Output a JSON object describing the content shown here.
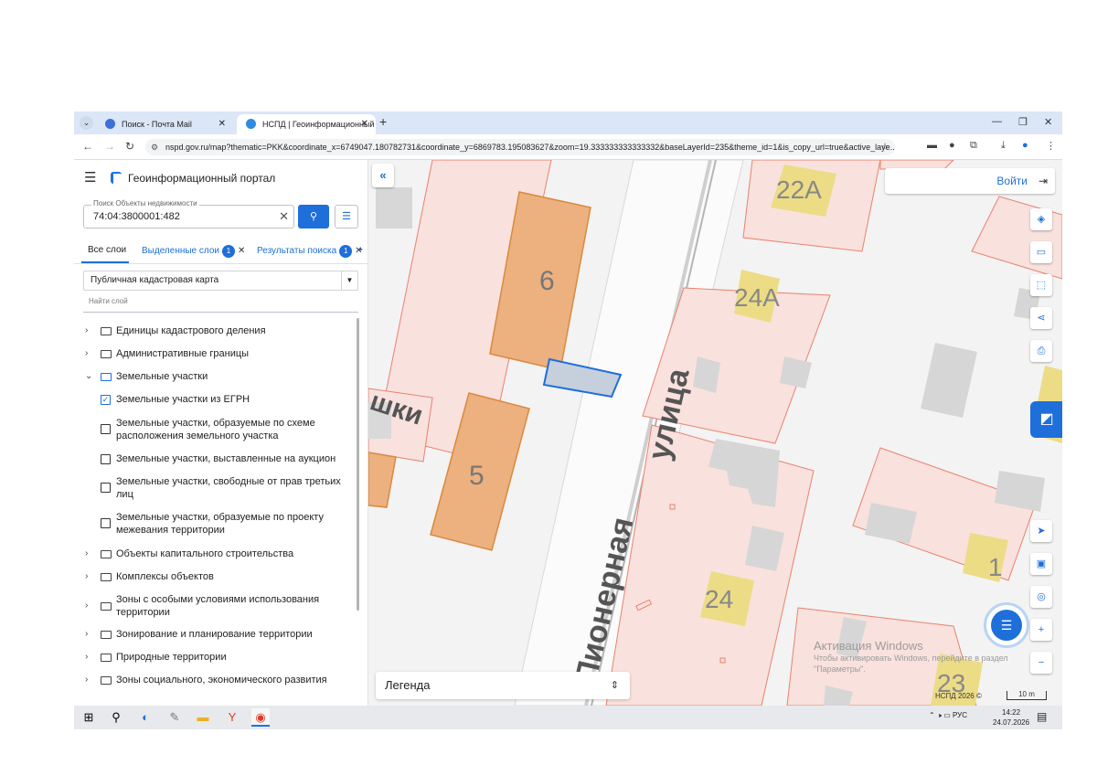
{
  "browser": {
    "tabs": [
      {
        "title": "Поиск - Почта Mail",
        "active": false
      },
      {
        "title": "НСПД | Геоинформационный",
        "active": true
      }
    ],
    "new_tab_icon": "plus-icon",
    "url": "nspd.gov.ru/map?thematic=PKK&coordinate_x=6749047.180782731&coordinate_y=6869783.195083627&zoom=19.333333333333332&baseLayerId=235&theme_id=1&is_copy_url=true&active_laye..."
  },
  "sidebar": {
    "title": "Геоинформационный портал",
    "search": {
      "label": "Поиск Объекты недвижимости",
      "value": "74:04:3800001:482"
    },
    "tabs": {
      "all": "Все слои",
      "selected": "Выделенные слои",
      "selected_count": "1",
      "results": "Результаты поиска",
      "results_count": "1"
    },
    "layer_select": "Публичная кадастровая карта",
    "find_layer_placeholder": "Найти слой",
    "tree": [
      {
        "label": "Единицы кадастрового деления",
        "type": "folder"
      },
      {
        "label": "Административные границы",
        "type": "folder"
      },
      {
        "label": "Земельные участки",
        "type": "folder-open"
      },
      {
        "label": "Земельные участки из ЕГРН",
        "type": "checkbox",
        "checked": true
      },
      {
        "label": "Земельные участки, образуемые по схеме",
        "label2": "расположения земельного участка",
        "type": "checkbox",
        "checked": false
      },
      {
        "label": "Земельные участки, выставленные на аукцион",
        "type": "checkbox",
        "checked": false
      },
      {
        "label": "Земельные участки, свободные от прав третьих",
        "label2": "лиц",
        "type": "checkbox",
        "checked": false
      },
      {
        "label": "Земельные участки, образуемые по проекту",
        "label2": "межевания территории",
        "type": "checkbox",
        "checked": false
      },
      {
        "label": "Объекты капитального строительства",
        "type": "folder"
      },
      {
        "label": "Комплексы объектов",
        "type": "folder"
      },
      {
        "label": "Зоны с особыми условиями использования",
        "label2": "территории",
        "type": "folder"
      },
      {
        "label": "Зонирование и планирование территории",
        "type": "folder"
      },
      {
        "label": "Природные территории",
        "type": "folder"
      },
      {
        "label": "Зоны социального, экономического развития",
        "type": "folder"
      }
    ]
  },
  "map": {
    "login": "Войти",
    "legend": "Легенда",
    "street_label_1": "Пионерная",
    "street_label_2": "улица",
    "street_fragment": "шки",
    "buildings": [
      "6",
      "5",
      "24А",
      "22А",
      "24",
      "23",
      "1"
    ],
    "win_activate_title": "Активация Windows",
    "win_activate_line1": "Чтобы активировать Windows, перейдите в раздел",
    "win_activate_line2": "\"Параметры\".",
    "copyright": "НСПД 2026 ©",
    "scale": "10 m",
    "colors": {
      "parcel_fill": "#f9e1dd",
      "parcel_stroke": "#e8826f",
      "building_fill": "#edb07f",
      "selected": "#1e6fd9",
      "accent": "#1e6fd9"
    }
  },
  "taskbar": {
    "lang": "РУС",
    "time": "14:22",
    "date": "24.07.2026"
  }
}
